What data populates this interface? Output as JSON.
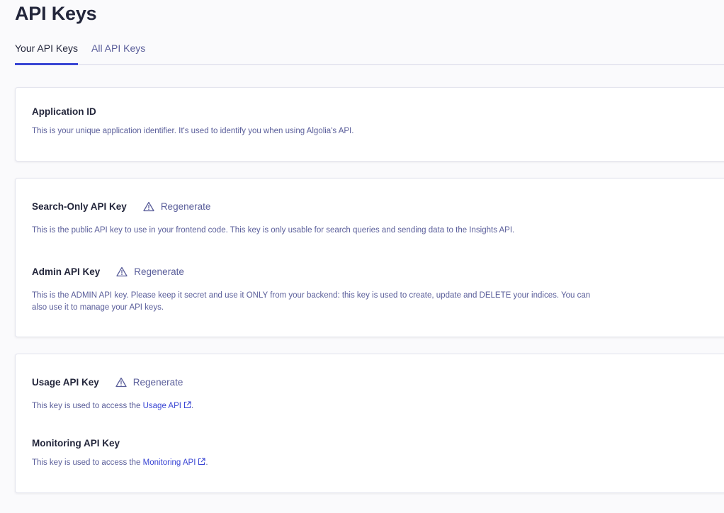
{
  "header": {
    "title": "API Keys"
  },
  "tabs": [
    {
      "label": "Your API Keys",
      "active": true
    },
    {
      "label": "All API Keys",
      "active": false
    }
  ],
  "application_id": {
    "title": "Application ID",
    "description": "This is your unique application identifier. It's used to identify you when using Algolia's API."
  },
  "search_only_key": {
    "title": "Search-Only API Key",
    "regenerate_label": "Regenerate",
    "description": "This is the public API key to use in your frontend code. This key is only usable for search queries and sending data to the Insights API."
  },
  "admin_key": {
    "title": "Admin API Key",
    "regenerate_label": "Regenerate",
    "description": "This is the ADMIN API key. Please keep it secret and use it ONLY from your backend: this key is used to create, update and DELETE your indices. You can also use it to manage your API keys."
  },
  "usage_key": {
    "title": "Usage API Key",
    "regenerate_label": "Regenerate",
    "description_prefix": "This key is used to access the ",
    "link_label": "Usage API",
    "description_suffix": "."
  },
  "monitoring_key": {
    "title": "Monitoring API Key",
    "description_prefix": "This key is used to access the ",
    "link_label": "Monitoring API",
    "description_suffix": "."
  },
  "colors": {
    "accent": "#3a46d4",
    "muted_text": "#5a5e9a",
    "heading": "#23263b",
    "background": "#fafafc"
  },
  "icons": {
    "regenerate": "warning-triangle-icon",
    "external_link": "external-link-icon"
  }
}
